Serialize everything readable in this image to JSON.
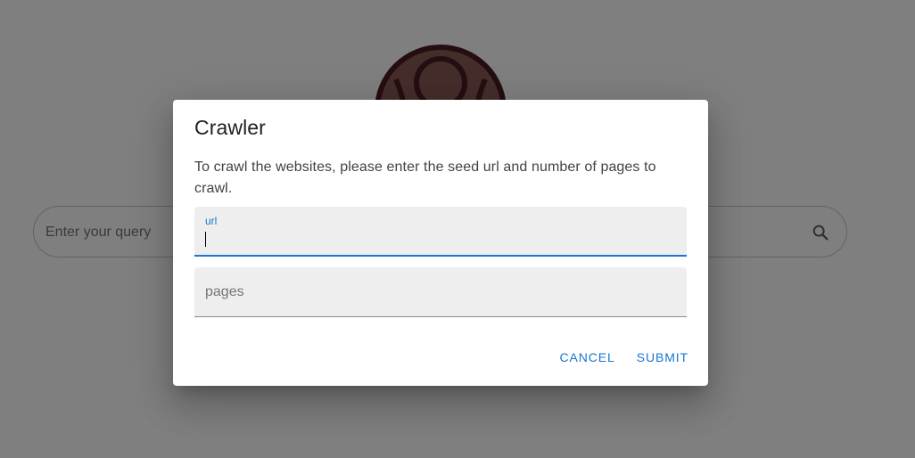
{
  "search": {
    "placeholder": "Enter your query",
    "button_icon": "search-icon"
  },
  "dialog": {
    "title": "Crawler",
    "text": "To crawl the websites, please enter the seed url and number of pages to crawl.",
    "url_field": {
      "label": "url",
      "value": ""
    },
    "pages_field": {
      "label": "pages",
      "value": ""
    },
    "cancel_label": "CANCEL",
    "submit_label": "SUBMIT"
  },
  "colors": {
    "accent": "#1976d2",
    "logo_dark": "#4a1c22",
    "logo_fill": "#8a5a55"
  }
}
